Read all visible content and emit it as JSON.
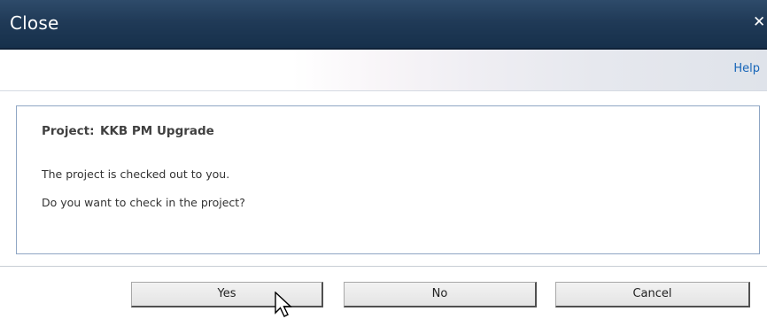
{
  "window": {
    "title": "Close",
    "close_icon": "close-icon"
  },
  "toolbar": {
    "help_label": "Help"
  },
  "content": {
    "project_label": "Project:",
    "project_name": "KKB PM Upgrade",
    "message_line1": "The project is checked out to you.",
    "message_line2": "Do you want to check in the project?"
  },
  "buttons": {
    "yes_label": "Yes",
    "no_label": "No",
    "cancel_label": "Cancel"
  },
  "colors": {
    "titlebar": "#203a57",
    "help_link": "#1665b8",
    "content_border": "#8fa6c4"
  }
}
